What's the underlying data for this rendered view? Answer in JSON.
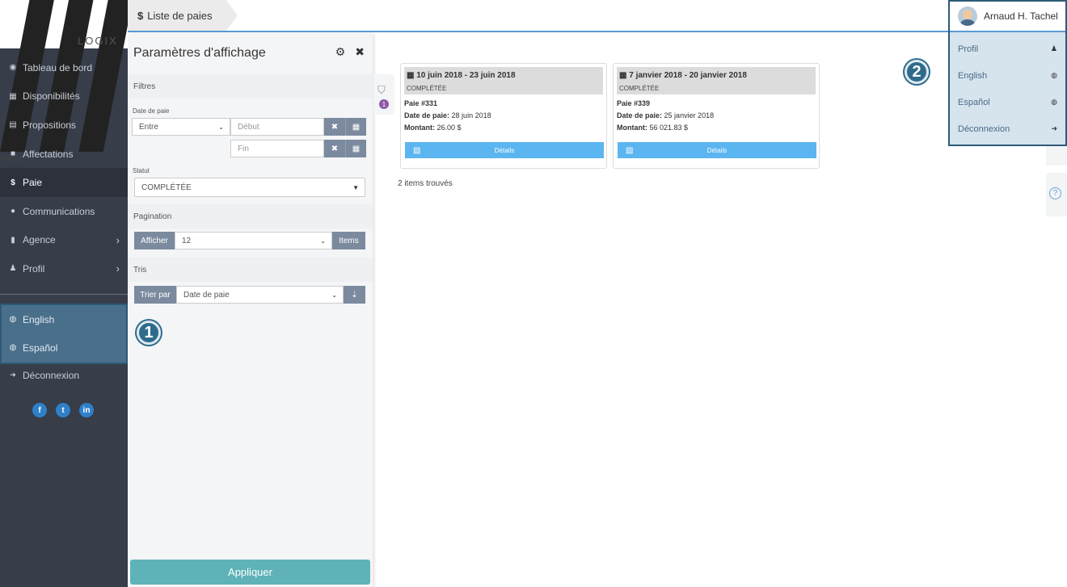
{
  "logo": {
    "main": "PRIM",
    "sub": "LOGIX"
  },
  "sidebar": {
    "items": [
      {
        "icon": "dashboard-icon",
        "label": "Tableau de bord"
      },
      {
        "icon": "calendar-icon",
        "label": "Disponibilités"
      },
      {
        "icon": "proposals-icon",
        "label": "Propositions"
      },
      {
        "icon": "briefcase-icon",
        "label": "Affectations"
      },
      {
        "icon": "dollar-icon",
        "label": "Paie",
        "active": true
      },
      {
        "icon": "chat-icon",
        "label": "Communications"
      },
      {
        "icon": "building-icon",
        "label": "Agence",
        "chevron": true
      },
      {
        "icon": "user-icon",
        "label": "Profil",
        "chevron": true
      }
    ],
    "languages": [
      {
        "label": "English"
      },
      {
        "label": "Español"
      }
    ],
    "logout": "Déconnexion"
  },
  "breadcrumb": {
    "symbol": "$",
    "label": "Liste de paies"
  },
  "filter_panel": {
    "title": "Paramètres d'affichage",
    "filters_label": "Filtres",
    "pay_date_label": "Date de paie",
    "range_operator": "Entre",
    "start_placeholder": "Début",
    "end_placeholder": "Fin",
    "status_label": "Statut",
    "status_value": "COMPLÉTÉE",
    "pagination_label": "Pagination",
    "show_label": "Afficher",
    "page_size": "12",
    "items_label": "Items",
    "sort_section_label": "Tris",
    "sort_by_label": "Trier par",
    "sort_field": "Date de paie",
    "apply_label": "Appliquer",
    "active_filter_count": "1"
  },
  "callouts": {
    "one": "1",
    "two": "2"
  },
  "cards": [
    {
      "dates": "10 juin 2018 - 23 juin 2018",
      "status": "COMPLÉTÉE",
      "pay_number": "Paie #331",
      "pay_date_label": "Date de paie:",
      "pay_date": "28 juin 2018",
      "amount_label": "Montant:",
      "amount": "26.00 $",
      "details_label": "Détails"
    },
    {
      "dates": "7 janvier 2018 - 20 janvier 2018",
      "status": "COMPLÉTÉE",
      "pay_number": "Paie #339",
      "pay_date_label": "Date de paie:",
      "pay_date": "25 janvier 2018",
      "amount_label": "Montant:",
      "amount": "56 021.83 $",
      "details_label": "Détails"
    }
  ],
  "results_found": "2 items trouvés",
  "user_menu": {
    "name": "Arnaud H. Tachel",
    "items": [
      {
        "label": "Profil",
        "icon": "user-icon"
      },
      {
        "label": "English",
        "icon": "globe-icon"
      },
      {
        "label": "Español",
        "icon": "globe-icon"
      },
      {
        "label": "Déconnexion",
        "icon": "logout-icon"
      }
    ]
  },
  "help_icon": "help-icon"
}
